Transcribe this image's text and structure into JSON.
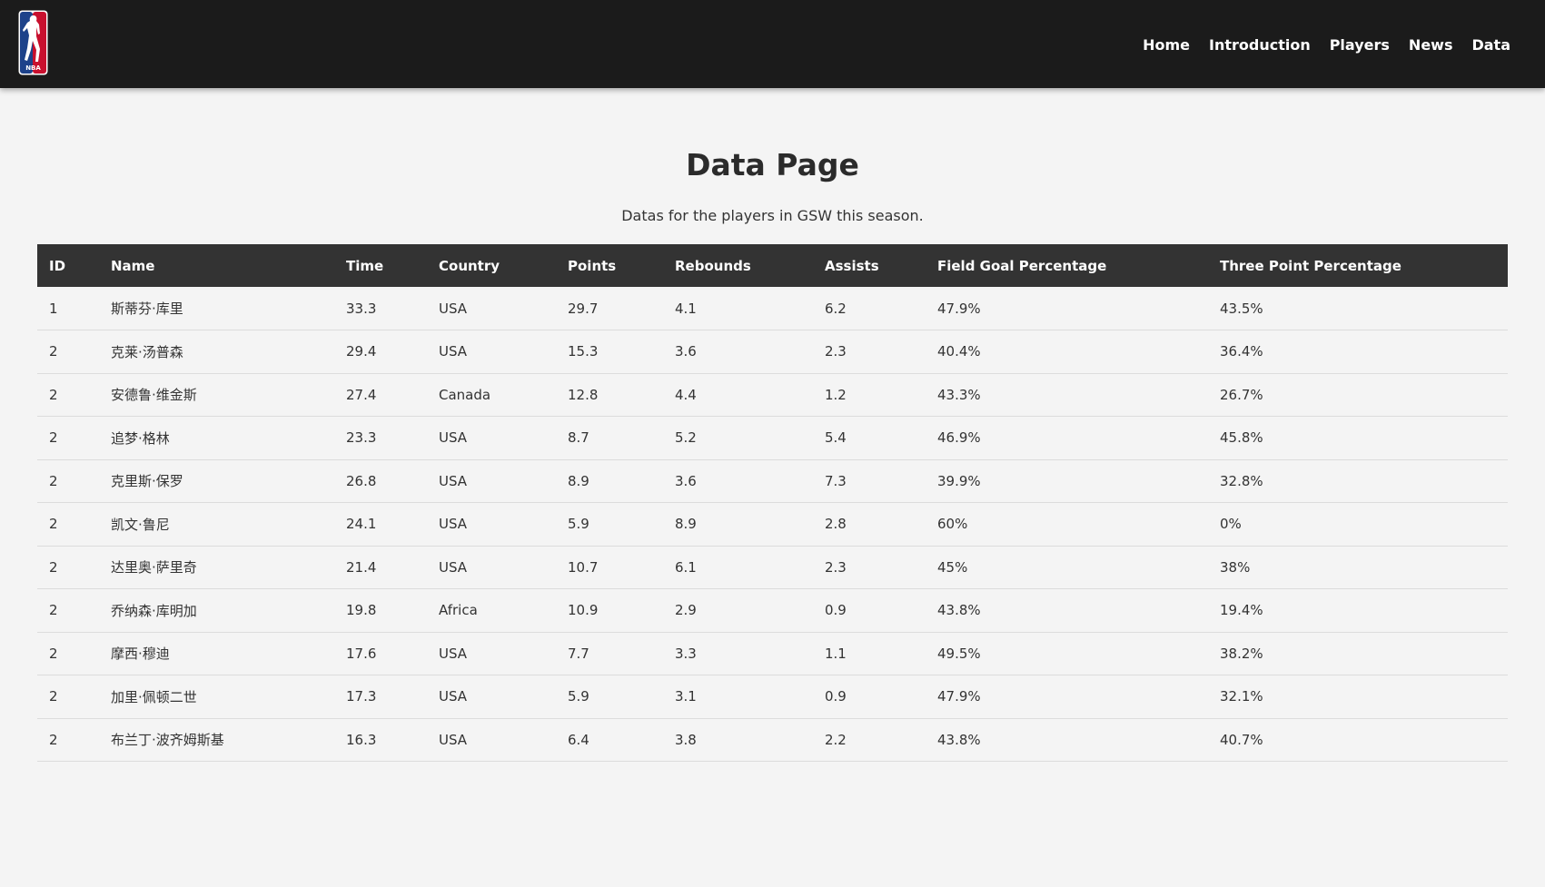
{
  "nav": {
    "logo_alt": "NBA",
    "links": [
      "Home",
      "Introduction",
      "Players",
      "News",
      "Data"
    ]
  },
  "main": {
    "title": "Data Page",
    "subtitle": "Datas for the players in GSW this season."
  },
  "table": {
    "headers": [
      "ID",
      "Name",
      "Time",
      "Country",
      "Points",
      "Rebounds",
      "Assists",
      "Field Goal Percentage",
      "Three Point Percentage"
    ],
    "rows": [
      [
        "1",
        "斯蒂芬·库里",
        "33.3",
        "USA",
        "29.7",
        "4.1",
        "6.2",
        "47.9%",
        "43.5%"
      ],
      [
        "2",
        "克莱·汤普森",
        "29.4",
        "USA",
        "15.3",
        "3.6",
        "2.3",
        "40.4%",
        "36.4%"
      ],
      [
        "2",
        "安德鲁·维金斯",
        "27.4",
        "Canada",
        "12.8",
        "4.4",
        "1.2",
        "43.3%",
        "26.7%"
      ],
      [
        "2",
        "追梦·格林",
        "23.3",
        "USA",
        "8.7",
        "5.2",
        "5.4",
        "46.9%",
        "45.8%"
      ],
      [
        "2",
        "克里斯·保罗",
        "26.8",
        "USA",
        "8.9",
        "3.6",
        "7.3",
        "39.9%",
        "32.8%"
      ],
      [
        "2",
        "凯文·鲁尼",
        "24.1",
        "USA",
        "5.9",
        "8.9",
        "2.8",
        "60%",
        "0%"
      ],
      [
        "2",
        "达里奥·萨里奇",
        "21.4",
        "USA",
        "10.7",
        "6.1",
        "2.3",
        "45%",
        "38%"
      ],
      [
        "2",
        "乔纳森·库明加",
        "19.8",
        "Africa",
        "10.9",
        "2.9",
        "0.9",
        "43.8%",
        "19.4%"
      ],
      [
        "2",
        "摩西·穆迪",
        "17.6",
        "USA",
        "7.7",
        "3.3",
        "1.1",
        "49.5%",
        "38.2%"
      ],
      [
        "2",
        "加里·佩顿二世",
        "17.3",
        "USA",
        "5.9",
        "3.1",
        "0.9",
        "47.9%",
        "32.1%"
      ],
      [
        "2",
        "布兰丁·波齐姆斯基",
        "16.3",
        "USA",
        "6.4",
        "3.8",
        "2.2",
        "43.8%",
        "40.7%"
      ]
    ]
  },
  "colors": {
    "navbar_bg": "#1b1b1b",
    "table_header_bg": "#333333",
    "page_bg": "#f4f4f4",
    "logo_blue": "#1d428a",
    "logo_red": "#c8102e"
  }
}
